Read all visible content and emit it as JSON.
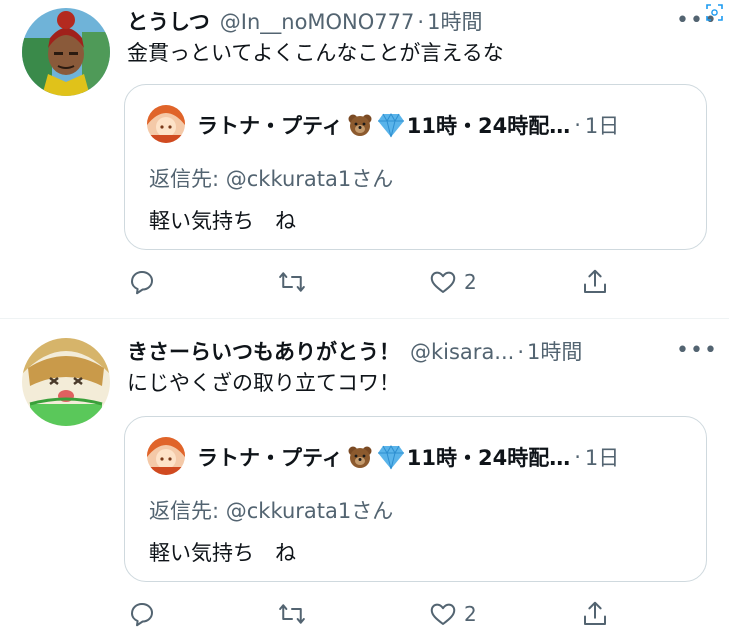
{
  "tweets": [
    {
      "name": "とうしつ",
      "handle": "@In__noMONO777",
      "dot": "·",
      "time": "1時間",
      "more": "•••",
      "text": "金貫っといてよくこんなことが言えるな",
      "quote": {
        "name": "ラトナ・プティ",
        "name_suffix": "11時・24時配…",
        "dot": "·",
        "time": "1日",
        "reply": "返信先: @ckkurata1さん",
        "text": "軽い気持ち　ね"
      },
      "likes": "2"
    },
    {
      "name": "きさーらいつもありがとう！",
      "handle": "@kisara...",
      "dot": "·",
      "time": "1時間",
      "more": "•••",
      "text": "にじやくざの取り立てコワ！",
      "quote": {
        "name": "ラトナ・プティ",
        "name_suffix": "11時・24時配…",
        "dot": "·",
        "time": "1日",
        "reply": "返信先: @ckkurata1さん",
        "text": "軽い気持ち　ね"
      },
      "likes": "2"
    }
  ],
  "colors": {
    "text": "#0f1419",
    "muted": "#536471",
    "border": "#cfd9de",
    "accent": "#1d9bf0"
  },
  "icons": [
    "reply-icon",
    "retweet-icon",
    "like-icon",
    "share-icon",
    "more-icon",
    "scan-icon",
    "bear-emoji",
    "diamond-emoji"
  ]
}
